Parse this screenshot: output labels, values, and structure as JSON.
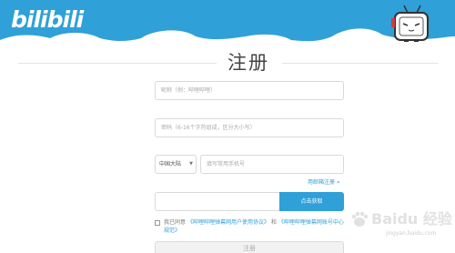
{
  "header": {
    "logo_text": "bilibili",
    "brand_color": "#2fa0d8"
  },
  "title": "注册",
  "form": {
    "nickname_placeholder": "昵称（例：哔哩哔哩）",
    "password_placeholder": "密码（6-16个字符组成，区分大小写）",
    "region_value": "中国大陆",
    "region_arrow": "▼",
    "phone_placeholder": "填写常用手机号",
    "email_register_link": "用邮箱注册 »",
    "code_input_value": "",
    "code_button_label": "点击获取",
    "agreement_prefix": "我已同意",
    "agreement_link1": "《哔哩哔哩弹幕网用户使用协议》",
    "agreement_and": "和",
    "agreement_link2": "《哔哩哔哩弹幕网账号中心规范》",
    "register_button_label": "注册"
  },
  "watermark": {
    "text": "Baidu 经验",
    "url": "jingyan.baidu.com"
  }
}
